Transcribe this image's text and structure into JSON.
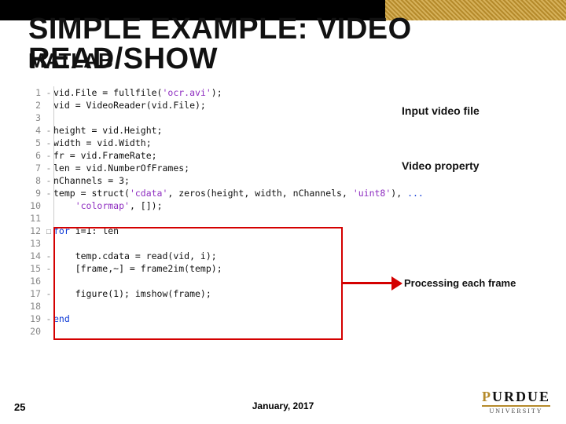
{
  "header": {
    "title": "SIMPLE EXAMPLE: VIDEO READ/SHOW",
    "subtitle": "MATLAB"
  },
  "annotations": {
    "input_video_file": "Input video file",
    "video_property": "Video property",
    "processing_each_frame": "Processing each frame"
  },
  "code": [
    {
      "n": "1",
      "fold": "-",
      "txt": "vid.File = fullfile(",
      "str": "'ocr.avi'",
      "txt2": ");"
    },
    {
      "n": "2",
      "txt": "vid = VideoReader(vid.File);"
    },
    {
      "n": "3",
      "txt": ""
    },
    {
      "n": "4",
      "fold": "-",
      "txt": "height = vid.Height;"
    },
    {
      "n": "5",
      "fold": "-",
      "txt": "width = vid.Width;"
    },
    {
      "n": "6",
      "fold": "-",
      "txt": "fr = vid.FrameRate;"
    },
    {
      "n": "7",
      "fold": "-",
      "txt": "len = vid.NumberOfFrames;"
    },
    {
      "n": "8",
      "fold": "-",
      "txt": "nChannels = 3;"
    },
    {
      "n": "9",
      "fold": "-",
      "txt": "temp = struct(",
      "str": "'cdata'",
      "txt2": ", zeros(height, width, nChannels, ",
      "str2": "'uint8'",
      "txt3": "), ",
      "cont": "..."
    },
    {
      "n": "10",
      "txt": "    ",
      "str": "'colormap'",
      "txt2": ", []);"
    },
    {
      "n": "11",
      "txt": ""
    },
    {
      "n": "12",
      "fold": "☐",
      "kw": "for",
      "txt": " i=1: len"
    },
    {
      "n": "13",
      "txt": ""
    },
    {
      "n": "14",
      "fold": "-",
      "txt": "    temp.cdata = read(vid, i);"
    },
    {
      "n": "15",
      "fold": "-",
      "txt": "    [frame,~] = frame2im(temp);"
    },
    {
      "n": "16",
      "txt": ""
    },
    {
      "n": "17",
      "fold": "-",
      "txt": "    figure(1); imshow(frame);"
    },
    {
      "n": "18",
      "txt": ""
    },
    {
      "n": "19",
      "fold": "-",
      "kw": "end"
    },
    {
      "n": "20",
      "txt": ""
    }
  ],
  "footer": {
    "slide_number": "25",
    "date": "January, 2017",
    "logo_main": "PURDUE",
    "logo_sub": "UNIVERSITY"
  }
}
